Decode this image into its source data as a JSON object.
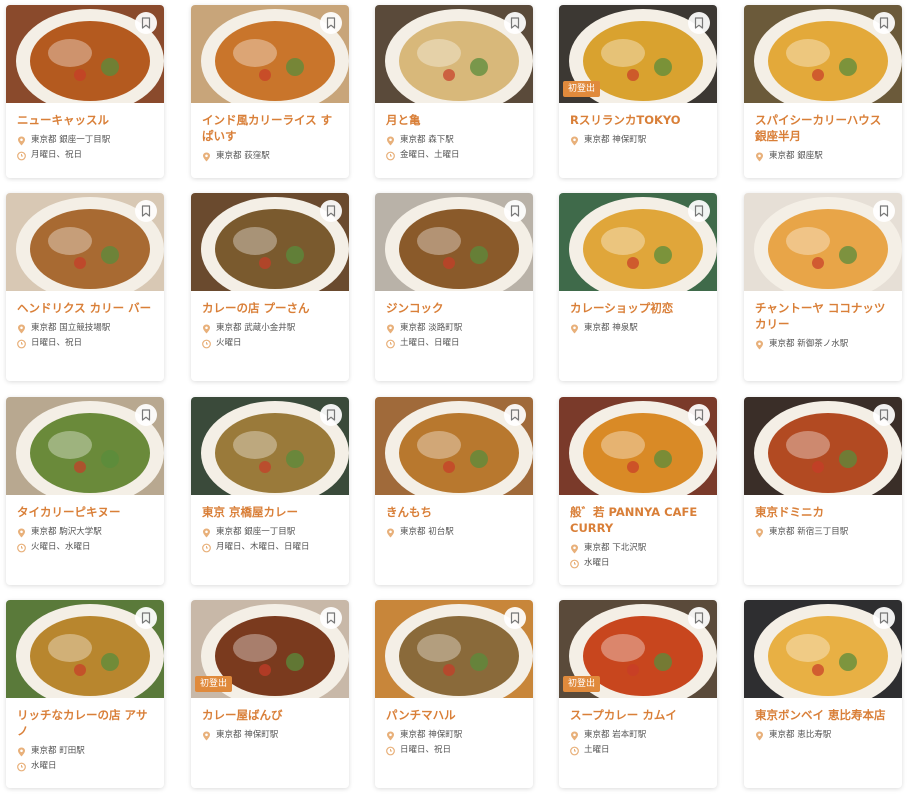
{
  "colors": {
    "title": "#d97f38",
    "badge": "#e08a3c",
    "icon": "#e8b07a"
  },
  "icons": {
    "bookmark": "bookmark-icon",
    "location": "location-pin-icon",
    "holiday": "clock-icon"
  },
  "cards": [
    {
      "name": "ニューキャッスル",
      "location": "東京都 銀座一丁目駅",
      "holiday": "月曜日、祝日",
      "badge": "",
      "plate": "#b45a1f",
      "bg": "#8a4a2c"
    },
    {
      "name": "インド風カリーライス すぱいす",
      "location": "東京都 荻窪駅",
      "holiday": "",
      "badge": "",
      "plate": "#c9752b",
      "bg": "#c8a57a"
    },
    {
      "name": "月と亀",
      "location": "東京都 森下駅",
      "holiday": "金曜日、土曜日",
      "badge": "",
      "plate": "#d8b87a",
      "bg": "#5a4a3a"
    },
    {
      "name": "RスリランカTOKYO",
      "location": "東京都 神保町駅",
      "holiday": "",
      "badge": "初登出",
      "plate": "#d9a22f",
      "bg": "#3c3833"
    },
    {
      "name": "スパイシーカリーハウス 銀座半月",
      "location": "東京都 銀座駅",
      "holiday": "",
      "badge": "",
      "plate": "#e3a93a",
      "bg": "#6b5a3a"
    },
    {
      "name": "ヘンドリクス カリー バー",
      "location": "東京都 国立競技場駅",
      "holiday": "日曜日、祝日",
      "badge": "",
      "plate": "#a86a32",
      "bg": "#d8c8b4"
    },
    {
      "name": "カレーの店 プーさん",
      "location": "東京都 武蔵小金井駅",
      "holiday": "火曜日",
      "badge": "",
      "plate": "#7a5a2e",
      "bg": "#6a4a2e"
    },
    {
      "name": "ジンコック",
      "location": "東京都 淡路町駅",
      "holiday": "土曜日、日曜日",
      "badge": "",
      "plate": "#8a5a2a",
      "bg": "#b9b2a8"
    },
    {
      "name": "カレーショップ初恋",
      "location": "東京都 神泉駅",
      "holiday": "",
      "badge": "",
      "plate": "#e0a63a",
      "bg": "#3f6a4a"
    },
    {
      "name": "チャントーヤ ココナッツカリー",
      "location": "東京都 新御茶ノ水駅",
      "holiday": "",
      "badge": "",
      "plate": "#e8a548",
      "bg": "#e6dfd6"
    },
    {
      "name": "タイカリーピキヌー",
      "location": "東京都 駒沢大学駅",
      "holiday": "火曜日、水曜日",
      "badge": "",
      "plate": "#6a8a3a",
      "bg": "#b8a890"
    },
    {
      "name": "東京 京橋屋カレー",
      "location": "東京都 銀座一丁目駅",
      "holiday": "月曜日、木曜日、日曜日",
      "badge": "",
      "plate": "#9a7a3a",
      "bg": "#3a4a3a"
    },
    {
      "name": "きんもち",
      "location": "東京都 初台駅",
      "holiday": "",
      "badge": "",
      "plate": "#b8782e",
      "bg": "#a06a3a"
    },
    {
      "name": "般゛若 PANNYA CAFE CURRY",
      "location": "東京都 下北沢駅",
      "holiday": "水曜日",
      "badge": "",
      "plate": "#d98a26",
      "bg": "#7a3a2a"
    },
    {
      "name": "東京ドミニカ",
      "location": "東京都 新宿三丁目駅",
      "holiday": "",
      "badge": "",
      "plate": "#b24a22",
      "bg": "#3a2e28"
    },
    {
      "name": "リッチなカレーの店 アサノ",
      "location": "東京都 町田駅",
      "holiday": "水曜日",
      "badge": "",
      "plate": "#b8862e",
      "bg": "#5a7a3a"
    },
    {
      "name": "カレー屋ばんび",
      "location": "東京都 神保町駅",
      "holiday": "",
      "badge": "初登出",
      "plate": "#7a3a1e",
      "bg": "#c8b8a8"
    },
    {
      "name": "パンチマハル",
      "location": "東京都 神保町駅",
      "holiday": "日曜日、祝日",
      "badge": "",
      "plate": "#8a6a3a",
      "bg": "#c8863a"
    },
    {
      "name": "スープカレー カムイ",
      "location": "東京都 岩本町駅",
      "holiday": "土曜日",
      "badge": "初登出",
      "plate": "#c8461e",
      "bg": "#5a4a3a"
    },
    {
      "name": "東京ボンベイ 恵比寿本店",
      "location": "東京都 恵比寿駅",
      "holiday": "",
      "badge": "",
      "plate": "#e8b044",
      "bg": "#2e2e30"
    }
  ]
}
